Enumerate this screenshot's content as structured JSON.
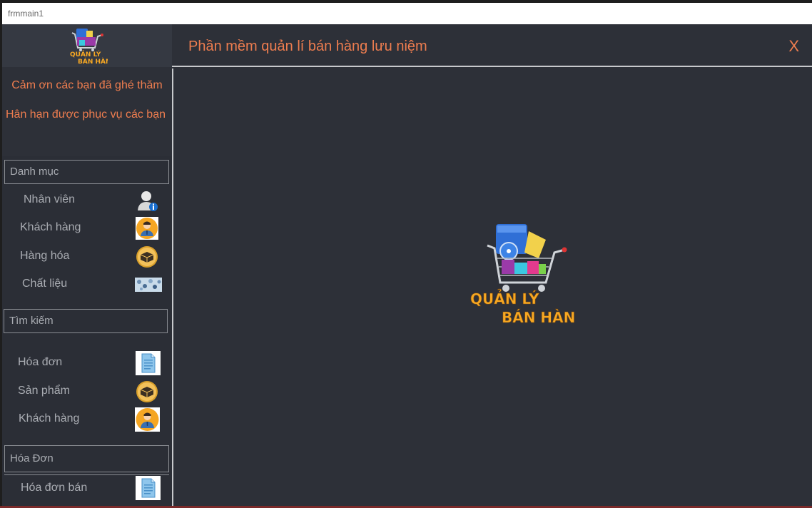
{
  "window": {
    "title": "frmmain1"
  },
  "brand": {
    "logo_line1": "QUẢN LÝ",
    "logo_line2": "BÁN HÀNG"
  },
  "welcome": {
    "line1": "Cảm ơn các bạn đã ghé thăm",
    "line2": "Hân hạn được phục vụ các bạn"
  },
  "header": {
    "title": "Phần mềm quản lí bán hàng lưu niệm",
    "close_label": "X"
  },
  "sidebar": {
    "groups": [
      {
        "label": "Danh mục",
        "items": [
          {
            "label": "Nhân viên",
            "icon": "user-info-icon"
          },
          {
            "label": "Khách hàng",
            "icon": "customer-avatar-icon"
          },
          {
            "label": "Hàng hóa",
            "icon": "goods-box-icon"
          },
          {
            "label": "Chất liệu",
            "icon": "material-texture-icon"
          }
        ]
      },
      {
        "label": "Tìm kiếm",
        "items": [
          {
            "label": "Hóa đơn",
            "icon": "invoice-document-icon"
          },
          {
            "label": "Sản phẩm",
            "icon": "goods-box-icon"
          },
          {
            "label": "Khách hàng",
            "icon": "customer-avatar-icon"
          }
        ]
      },
      {
        "label": "Hóa Đơn",
        "items": [
          {
            "label": "Hóa đơn bán",
            "icon": "invoice-document-icon"
          }
        ]
      }
    ]
  },
  "colors": {
    "accent": "#ee7d4f",
    "background": "#2d3038",
    "muted_text": "#a9acb2"
  }
}
